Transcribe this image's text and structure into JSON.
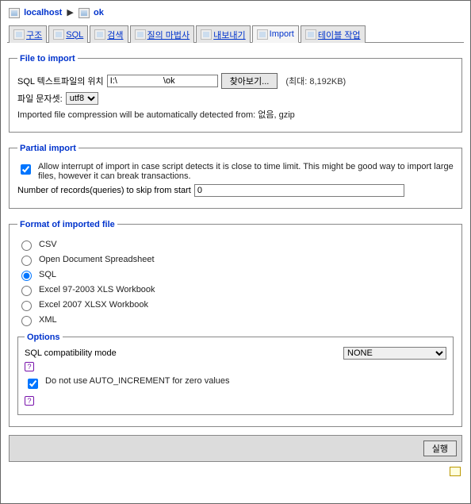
{
  "breadcrumb": {
    "host": "localhost",
    "db": "ok"
  },
  "tabs": [
    {
      "label": "구조"
    },
    {
      "label": "SQL"
    },
    {
      "label": "검색"
    },
    {
      "label": "질의 마법사"
    },
    {
      "label": "내보내기"
    },
    {
      "label": "Import"
    },
    {
      "label": "테이블 작업"
    }
  ],
  "file_import": {
    "legend": "File to import",
    "location_label": "SQL 텍스트파일의 위치",
    "location_value": "I:\\                   \\ok",
    "browse_btn": "찾아보기...",
    "max_size": "(최대: 8,192KB)",
    "charset_label": "파일 문자셋:",
    "charset_value": "utf8",
    "compression_note": "Imported file compression will be automatically detected from: 없음, gzip"
  },
  "partial_import": {
    "legend": "Partial import",
    "allow_interrupt": "Allow interrupt of import in case script detects it is close to time limit. This might be good way to import large files, however it can break transactions.",
    "skip_label": "Number of records(queries) to skip from start",
    "skip_value": "0"
  },
  "format": {
    "legend": "Format of imported file",
    "options": [
      "CSV",
      "Open Document Spreadsheet",
      "SQL",
      "Excel 97-2003 XLS Workbook",
      "Excel 2007 XLSX Workbook",
      "XML"
    ],
    "sub": {
      "legend": "Options",
      "compat_label": "SQL compatibility mode",
      "compat_value": "NONE",
      "auto_inc": "Do not use AUTO_INCREMENT for zero values"
    }
  },
  "footer": {
    "submit": "실행"
  }
}
